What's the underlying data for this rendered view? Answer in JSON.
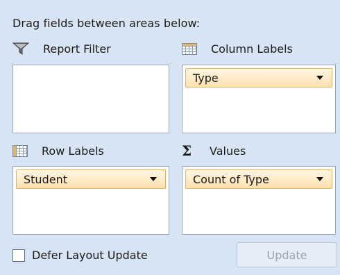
{
  "instructions": "Drag fields between areas below:",
  "areas": {
    "report_filter": {
      "label": "Report Filter",
      "icon": "filter-icon",
      "fields": []
    },
    "column_labels": {
      "label": "Column Labels",
      "icon": "column-grid-icon",
      "fields": [
        "Type"
      ]
    },
    "row_labels": {
      "label": "Row Labels",
      "icon": "row-grid-icon",
      "fields": [
        "Student"
      ]
    },
    "values": {
      "label": "Values",
      "icon": "sigma-icon",
      "fields": [
        "Count of Type"
      ]
    }
  },
  "footer": {
    "defer_label": "Defer Layout Update",
    "defer_checked": false,
    "update_label": "Update",
    "update_enabled": false
  },
  "colors": {
    "panel_bg": "#d6e4f4",
    "chip_border": "#e3b45e",
    "chip_fill": "#fde1b0"
  }
}
